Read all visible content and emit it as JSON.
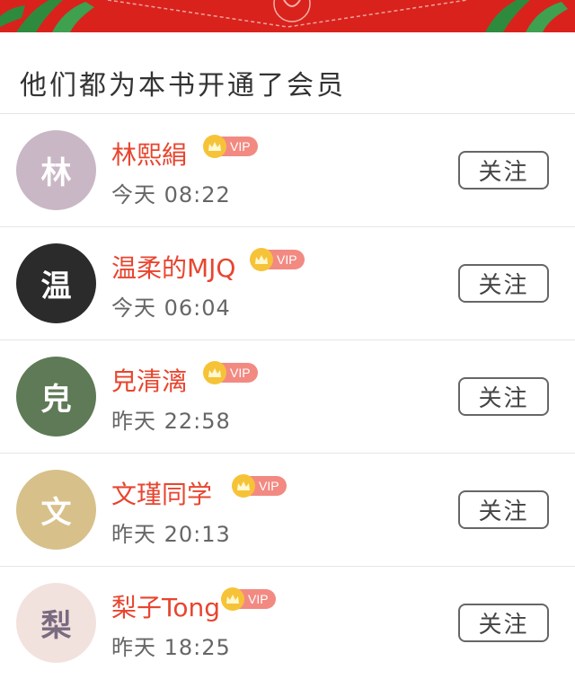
{
  "section_title": "他们都为本书开通了会员",
  "vip_badge_label": "VIP",
  "colors": {
    "banner": "#d9221c",
    "name": "#e8452f",
    "vip_badge": "#f28a82",
    "crown": "#f6c338"
  },
  "members": [
    {
      "name": "林熙絹",
      "time": "今天 08:22",
      "follow_label": "关注",
      "avatar_color": "#c9b7c6",
      "avatar_glyph": "林"
    },
    {
      "name": "温柔的MJQ",
      "time": "今天 06:04",
      "follow_label": "关注",
      "avatar_color": "#2b2b2b",
      "avatar_glyph": "温"
    },
    {
      "name": "皃清漓",
      "time": "昨天 22:58",
      "follow_label": "关注",
      "avatar_color": "#5f7a56",
      "avatar_glyph": "皃"
    },
    {
      "name": "文瑾同学",
      "time": "昨天 20:13",
      "follow_label": "关注",
      "avatar_color": "#d7c08a",
      "avatar_glyph": "文"
    },
    {
      "name": "梨子Tong",
      "time": "昨天 18:25",
      "follow_label": "关注",
      "avatar_color": "#f2e2de",
      "avatar_glyph": "梨"
    }
  ]
}
